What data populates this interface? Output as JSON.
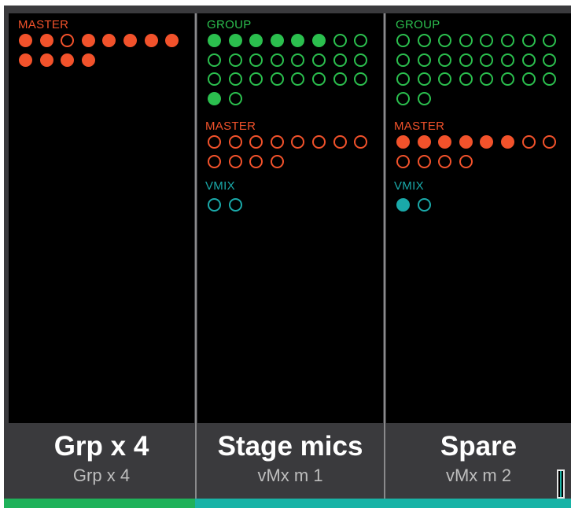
{
  "colors": {
    "master": "#f2522b",
    "group": "#2bbf4e",
    "vmix": "#1aa9a9",
    "strip_bg": "#000000",
    "footer_bg": "#3a3a3d",
    "busbar_group": "#1fb25a",
    "busbar_vmix": "#18b3a6"
  },
  "strips": [
    {
      "sections": [
        {
          "label": "MASTER",
          "kind": "master",
          "dots": [
            1,
            1,
            0,
            1,
            1,
            1,
            1,
            1,
            1,
            1,
            1,
            1
          ]
        }
      ],
      "footer": {
        "main": "Grp x  4",
        "sub": "Grp x  4"
      }
    },
    {
      "sections": [
        {
          "label": "GROUP",
          "kind": "group",
          "dots": [
            1,
            1,
            1,
            1,
            1,
            1,
            0,
            0,
            0,
            0,
            0,
            0,
            0,
            0,
            0,
            0,
            0,
            0,
            0,
            0,
            0,
            0,
            0,
            0,
            1,
            0
          ]
        },
        {
          "label": "MASTER",
          "kind": "master",
          "dots": [
            0,
            0,
            0,
            0,
            0,
            0,
            0,
            0,
            0,
            0,
            0,
            0
          ]
        },
        {
          "label": "VMIX",
          "kind": "vmix",
          "dots": [
            0,
            0
          ]
        }
      ],
      "footer": {
        "main": "Stage mics",
        "sub": "vMx m  1"
      }
    },
    {
      "sections": [
        {
          "label": "GROUP",
          "kind": "group",
          "dots": [
            0,
            0,
            0,
            0,
            0,
            0,
            0,
            0,
            0,
            0,
            0,
            0,
            0,
            0,
            0,
            0,
            0,
            0,
            0,
            0,
            0,
            0,
            0,
            0,
            0,
            0
          ]
        },
        {
          "label": "MASTER",
          "kind": "master",
          "dots": [
            1,
            1,
            1,
            1,
            1,
            1,
            0,
            0,
            0,
            0,
            0,
            0
          ]
        },
        {
          "label": "VMIX",
          "kind": "vmix",
          "dots": [
            1,
            0
          ]
        }
      ],
      "footer": {
        "main": "Spare",
        "sub": "vMx m  2"
      }
    }
  ],
  "meter": {
    "level": 1.0
  }
}
